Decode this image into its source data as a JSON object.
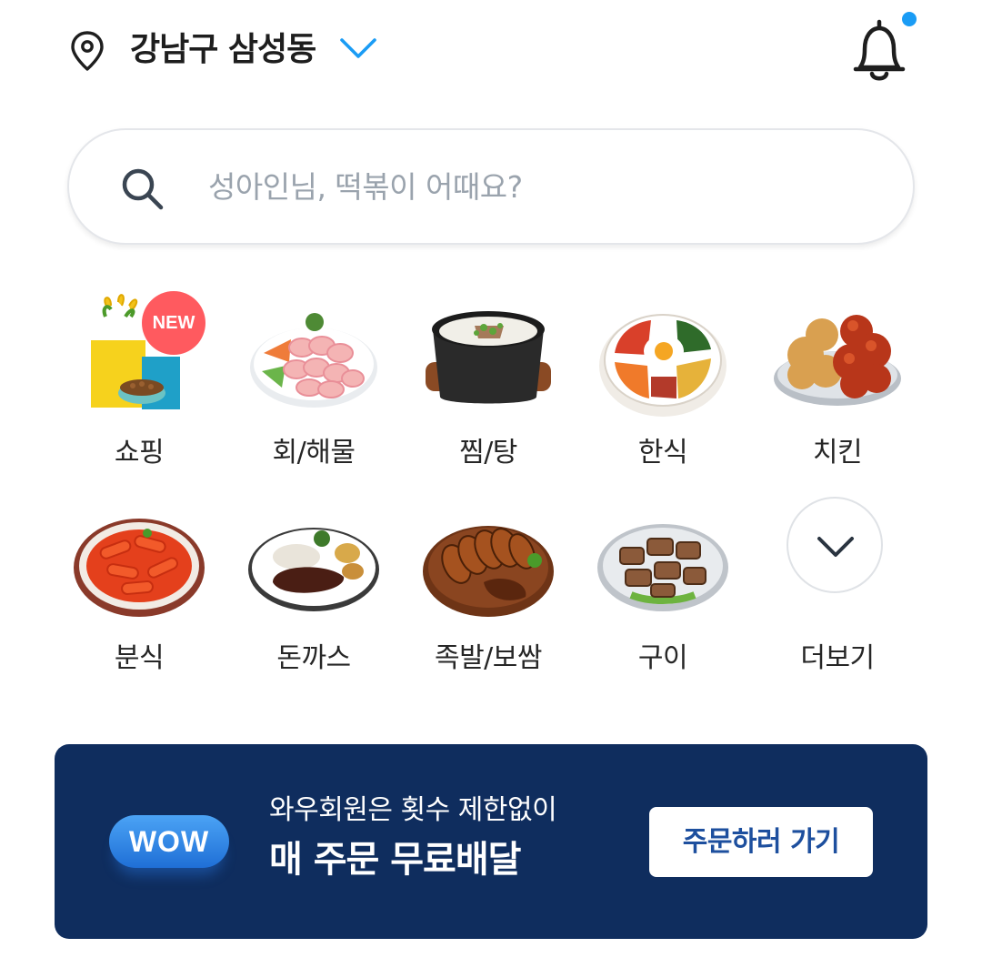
{
  "header": {
    "location": "강남구 삼성동",
    "location_icon": "map-pin-icon",
    "dropdown_icon": "chevron-down-icon",
    "notification_icon": "bell-icon",
    "has_unread_notification": true,
    "accent_color": "#1a9cf5"
  },
  "search": {
    "placeholder": "성아인님, 떡볶이 어때요?",
    "icon": "search-icon"
  },
  "categories": [
    {
      "label": "쇼핑",
      "badge": "NEW",
      "icon": "shopping-bag-icon"
    },
    {
      "label": "회/해물",
      "icon": "sashimi-icon"
    },
    {
      "label": "찜/탕",
      "icon": "stew-pot-icon"
    },
    {
      "label": "한식",
      "icon": "bibimbap-icon"
    },
    {
      "label": "치킨",
      "icon": "fried-chicken-icon"
    },
    {
      "label": "분식",
      "icon": "tteokbokki-icon"
    },
    {
      "label": "돈까스",
      "icon": "pork-cutlet-icon"
    },
    {
      "label": "족발/보쌈",
      "icon": "jokbal-icon"
    },
    {
      "label": "구이",
      "icon": "grilled-meat-icon"
    },
    {
      "label": "더보기",
      "icon": "chevron-down-icon"
    }
  ],
  "banner": {
    "badge": "WOW",
    "subtitle": "와우회원은 횟수 제한없이",
    "title": "매 주문 무료배달",
    "button_label": "주문하러 가기",
    "background_color": "#0f2d5e"
  }
}
